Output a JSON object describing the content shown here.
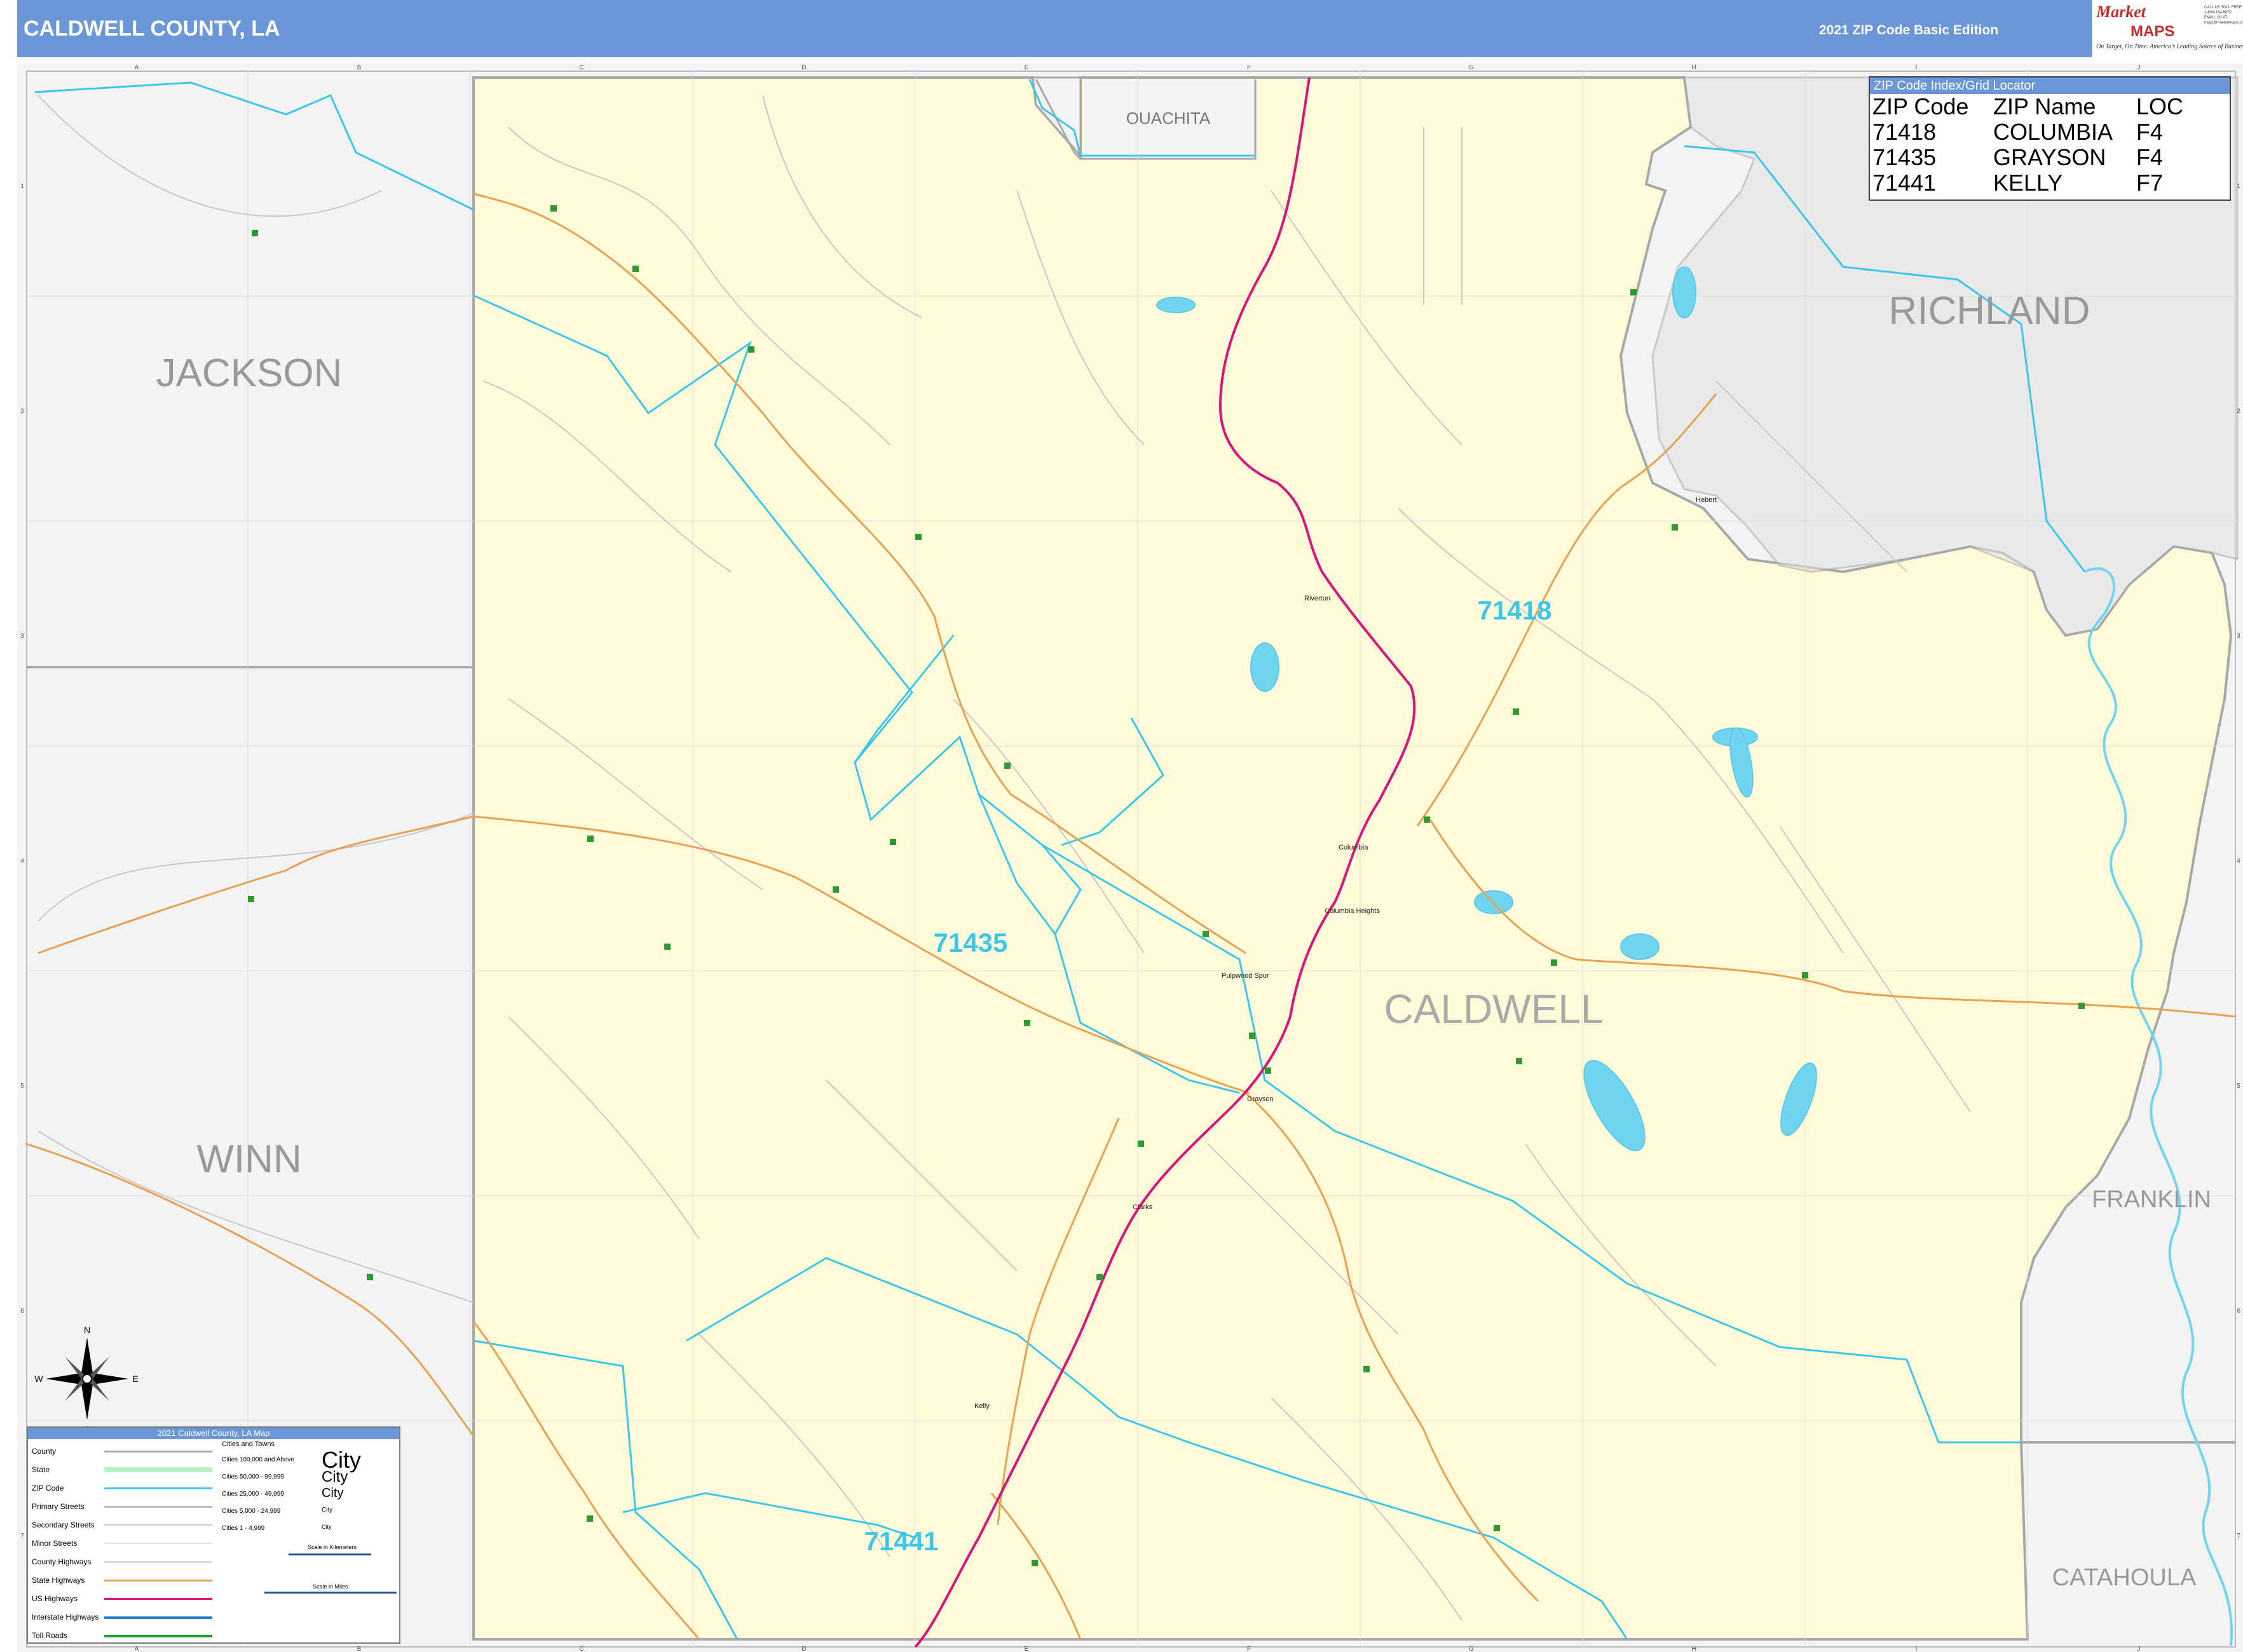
{
  "header": {
    "title": "CALDWELL COUNTY, LA",
    "edition": "2021 ZIP Code Basic Edition",
    "logo_mark": "Market",
    "logo_maps": "MAPS",
    "logo_tagline": "On Target, On Time. America's Leading Source of Business Maps",
    "logo_contact": "CALL US TOLL FREE 1-800-334-8870 EMAIL US AT: maps@marketmaps.com"
  },
  "map": {
    "counties": {
      "main": "CALDWELL",
      "ouachita": "OUACHITA",
      "richland": "RICHLAND",
      "jackson": "JACKSON",
      "winn": "WINN",
      "franklin": "FRANKLIN",
      "catahoula": "CATAHOULA"
    },
    "zip_labels": {
      "z71418": "71418",
      "z71435": "71435",
      "z71441": "71441"
    },
    "places": {
      "riverton": "Riverton",
      "hebert": "Hebert",
      "columbia": "Columbia",
      "columbia_heights": "Columbia Heights",
      "pulpwood": "Pulpwood Spur",
      "grayson": "Grayson",
      "clarks": "Clarks",
      "kelly": "Kelly"
    },
    "grid_cols": [
      "A",
      "B",
      "C",
      "D",
      "E",
      "F",
      "G",
      "H",
      "I",
      "J"
    ],
    "grid_rows": [
      "1",
      "2",
      "3",
      "4",
      "5",
      "6",
      "7"
    ],
    "compass": {
      "n": "N",
      "s": "S",
      "e": "E",
      "w": "W"
    },
    "colors": {
      "county_fill": "#fffbd9",
      "outside_fill": "#f3f3f3",
      "zip_boundary": "#3cc6ec",
      "us_highway": "#d6167a",
      "state_highway": "#e8a052",
      "water": "#6fd5f0",
      "county_line": "#a8a8a8"
    }
  },
  "zip_index": {
    "header": "ZIP Code Index/Grid Locator",
    "columns": [
      "ZIP Code",
      "ZIP Name",
      "LOC"
    ],
    "rows": [
      {
        "zip": "71418",
        "name": "COLUMBIA",
        "loc": "F4"
      },
      {
        "zip": "71435",
        "name": "GRAYSON",
        "loc": "F4"
      },
      {
        "zip": "71441",
        "name": "KELLY",
        "loc": "F7"
      }
    ]
  },
  "legend": {
    "title": "2021 Caldwell County, LA Map",
    "items": [
      "County",
      "State",
      "ZIP Code",
      "Primary Streets",
      "Secondary Streets",
      "Minor Streets",
      "County Highways",
      "State Highways",
      "US Highways",
      "Interstate Highways",
      "Toll Roads"
    ],
    "cities_header": "Cities and Towns",
    "city_classes": [
      "Cities 100,000 and Above",
      "Cities 50,000 - 99,999",
      "Cities 25,000 - 49,999",
      "Cities 5,000 - 24,999",
      "Cities 1 - 4,999"
    ],
    "city_samples": [
      "City",
      "City",
      "City",
      "City",
      "City"
    ],
    "scale_km": "Scale in Kilometers",
    "scale_mi": "Scale in Miles"
  }
}
